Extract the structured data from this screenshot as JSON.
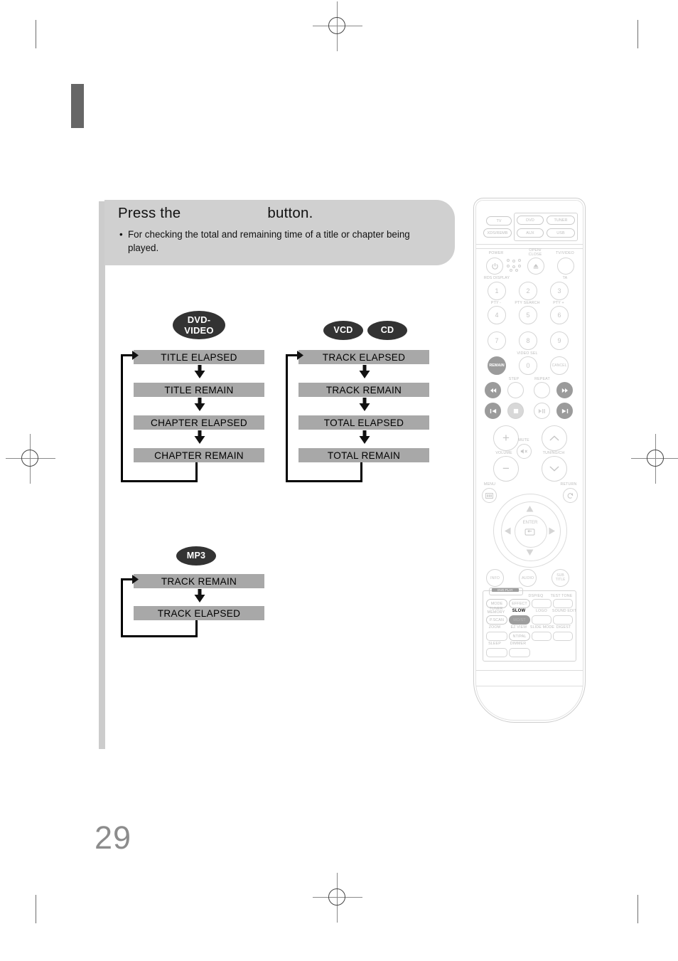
{
  "page": {
    "number": "29",
    "colors": {
      "header_panel": "#d0d0d0",
      "flow_box": "#a8a8a8",
      "badge": "#333333",
      "side_band": "#cccccc",
      "tab_bar": "#666666",
      "page_number": "#8c8c8c",
      "highlight_button": "#9b9b9b"
    }
  },
  "header": {
    "title_before": "Press the",
    "title_after": "button.",
    "bullet_marker": "•",
    "bullet_text": "For checking the total and remaining time of a title or chapter being played."
  },
  "flows": [
    {
      "id": "dvd-video",
      "badge": "DVD-\nVIDEO",
      "badge_line1": "DVD-",
      "badge_line2": "VIDEO",
      "steps": [
        "TITLE ELAPSED",
        "TITLE REMAIN",
        "CHAPTER ELAPSED",
        "CHAPTER REMAIN"
      ],
      "loops_back": true
    },
    {
      "id": "vcd-cd",
      "badges": [
        "VCD",
        "CD"
      ],
      "steps": [
        "TRACK ELAPSED",
        "TRACK REMAIN",
        "TOTAL ELAPSED",
        "TOTAL REMAIN"
      ],
      "loops_back": true
    },
    {
      "id": "mp3",
      "badge": "MP3",
      "steps": [
        "TRACK REMAIN",
        "TRACK ELAPSED"
      ],
      "loops_back": true
    }
  ],
  "remote": {
    "source_row1": [
      "TV",
      "DVD",
      "TUNER"
    ],
    "source_row2": [
      "XDS/REMB",
      "AUX",
      "USB"
    ],
    "power_label": "POWER",
    "power_icon": "power-icon",
    "open_close_label": "OPEN/\nCLOSE",
    "open_close_line1": "OPEN/",
    "open_close_line2": "CLOSE",
    "open_close_icon": "eject-icon",
    "tv_video_label": "TV/VIDEO",
    "rds_display_label": "RDS DISPLAY",
    "ta_label": "TA",
    "pty_minus_label": "PTY -",
    "pty_search_label": "PTY SEARCH",
    "pty_plus_label": "PTY +",
    "video_sel_label": "VIDEO SEL",
    "numbers": [
      "1",
      "2",
      "3",
      "4",
      "5",
      "6",
      "7",
      "8",
      "9",
      "0"
    ],
    "remain_label": "REMAIN",
    "cancel_label": "CANCEL",
    "step_label": "STEP",
    "repeat_label": "REPEAT",
    "transport": [
      "rewind-icon",
      "forward-icon",
      "prev-track-icon",
      "stop-icon",
      "play-pause-icon",
      "next-track-icon"
    ],
    "volume_label": "VOLUME",
    "volume_up": "+",
    "volume_down": "−",
    "mute_label": "MUTE",
    "mute_icon": "mute-icon",
    "tuning_ch_label": "TUNING/CH",
    "tuning_up_icon": "chevron-up-icon",
    "tuning_down_icon": "chevron-down-icon",
    "menu_label": "MENU",
    "menu_icon": "menu-icon",
    "return_label": "RETURN",
    "return_icon": "return-icon",
    "enter_label": "ENTER",
    "enter_icon": "enter-icon",
    "nav_up_icon": "arrow-up-icon",
    "nav_down_icon": "arrow-down-icon",
    "nav_left_icon": "arrow-left-icon",
    "nav_right_icon": "arrow-right-icon",
    "info_label": "INFO",
    "audio_label": "AUDIO",
    "subtitle_label": "SUB\nTITLE",
    "subtitle_line1": "SUB",
    "subtitle_line2": "TITLE",
    "dvd_play_tab": "DVD PLAY",
    "grid": [
      {
        "top": "",
        "label": "MODE",
        "pill": true
      },
      {
        "top": "",
        "label": "EFFECT",
        "pill": true
      },
      {
        "top": "DSP/EQ",
        "label": "",
        "pill": false
      },
      {
        "top": "TEST TONE",
        "label": "",
        "pill": false
      },
      {
        "top": "TUNER\nMEMORY",
        "label": "P.SCAN",
        "pill": true
      },
      {
        "top": "SLOW",
        "label": "MO/ST",
        "pill": true,
        "selected": true
      },
      {
        "top": "LOGO",
        "label": "",
        "pill": false
      },
      {
        "top": "SOUND EDIT",
        "label": "",
        "pill": false
      },
      {
        "top": "ZOOM",
        "label": "",
        "pill": false
      },
      {
        "top": "EZ VIEW",
        "label": "NT/PAL",
        "pill": true
      },
      {
        "top": "SLIDE MODE",
        "label": "",
        "pill": false
      },
      {
        "top": "DIGEST",
        "label": "",
        "pill": false
      },
      {
        "top": "SLEEP",
        "label": "",
        "pill": false
      },
      {
        "top": "DIMMER",
        "label": "",
        "pill": false
      }
    ],
    "tuner_memory_line1": "TUNER",
    "tuner_memory_line2": "MEMORY"
  }
}
